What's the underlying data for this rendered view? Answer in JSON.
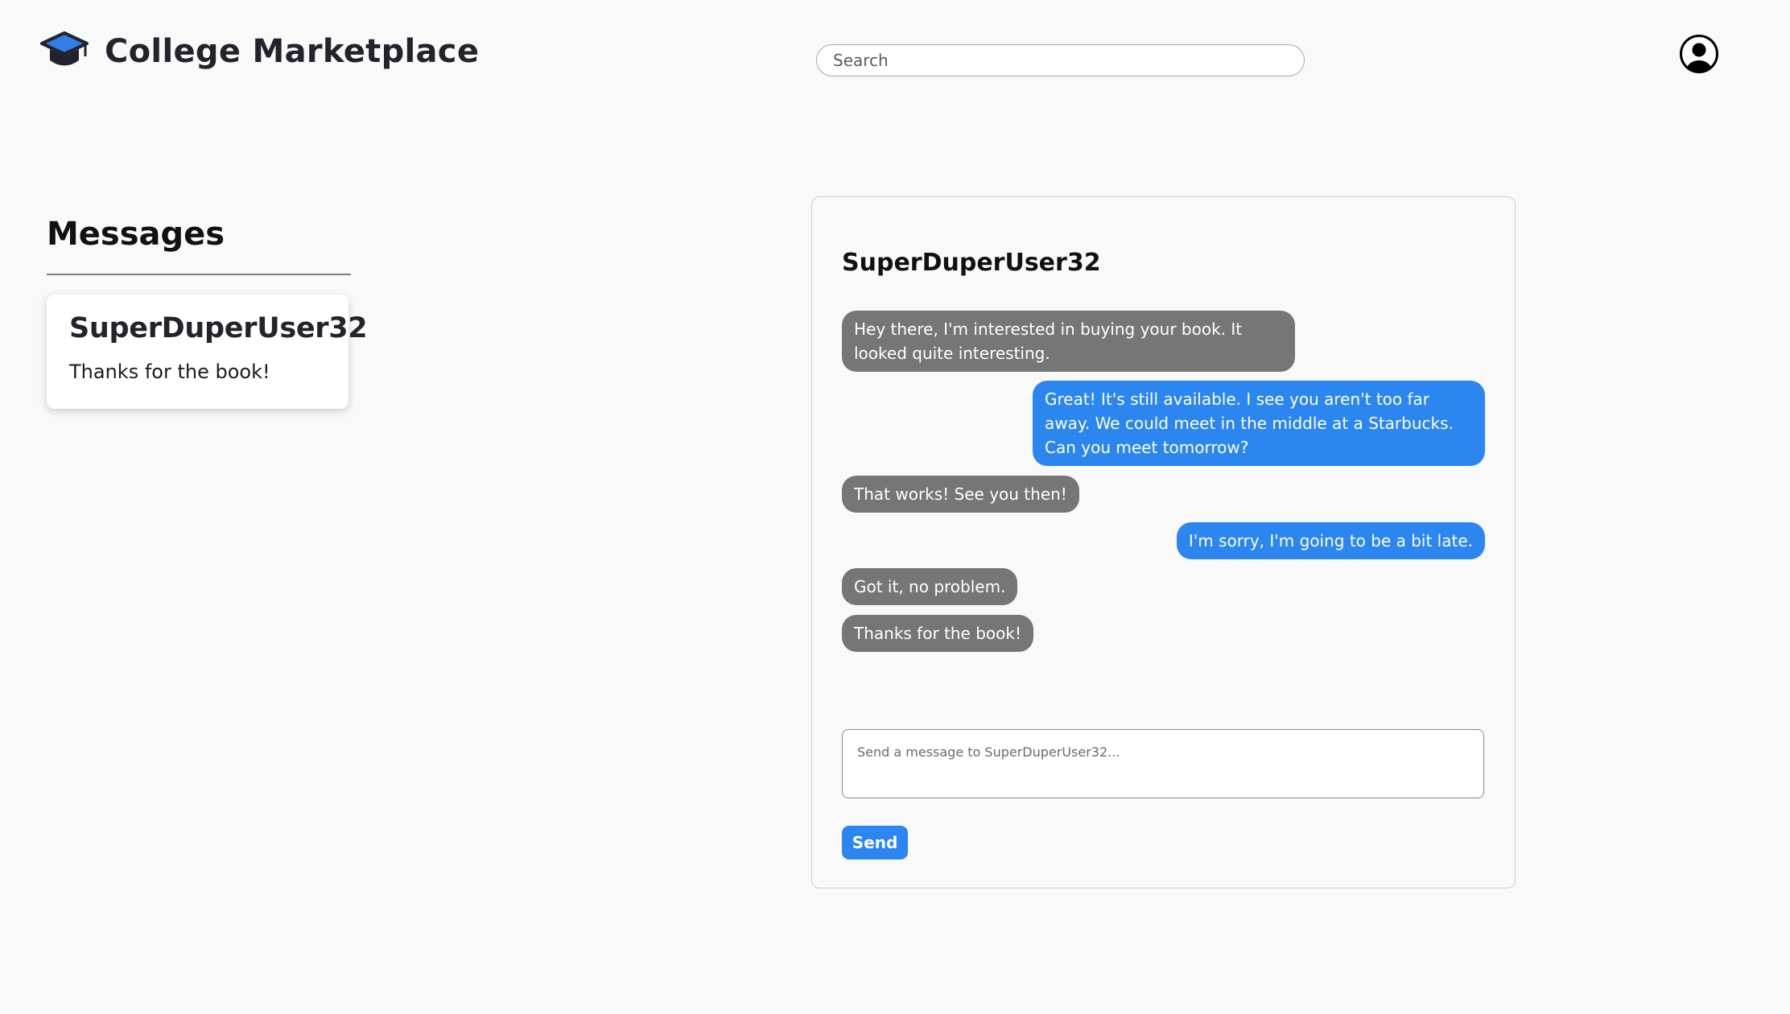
{
  "header": {
    "app_title": "College Marketplace",
    "logo_icon": "graduation-cap-icon",
    "search_placeholder": "Search",
    "profile_icon": "user-circle-icon"
  },
  "sidebar": {
    "title": "Messages",
    "conversations": [
      {
        "name": "SuperDuperUser32",
        "preview": "Thanks for the book!"
      }
    ]
  },
  "chat": {
    "contact_name": "SuperDuperUser32",
    "messages": [
      {
        "direction": "incoming",
        "text": "Hey there, I'm interested in buying your book. It looked quite interesting."
      },
      {
        "direction": "outgoing",
        "text": "Great! It's still available. I see you aren't too far away. We could meet in the middle at a Starbucks. Can you meet tomorrow?"
      },
      {
        "direction": "incoming",
        "text": "That works! See you then!"
      },
      {
        "direction": "outgoing",
        "text": "I'm sorry, I'm going to be a bit late."
      },
      {
        "direction": "incoming",
        "text": "Got it, no problem."
      },
      {
        "direction": "incoming",
        "text": "Thanks for the book!"
      }
    ],
    "compose_placeholder": "Send a message to SuperDuperUser32...",
    "send_label": "Send"
  },
  "colors": {
    "accent": "#2b86f0",
    "incoming_bubble": "#767676",
    "background": "#f9f9f9",
    "logo_blue": "#2f7fe6",
    "logo_dark": "#23232e"
  }
}
